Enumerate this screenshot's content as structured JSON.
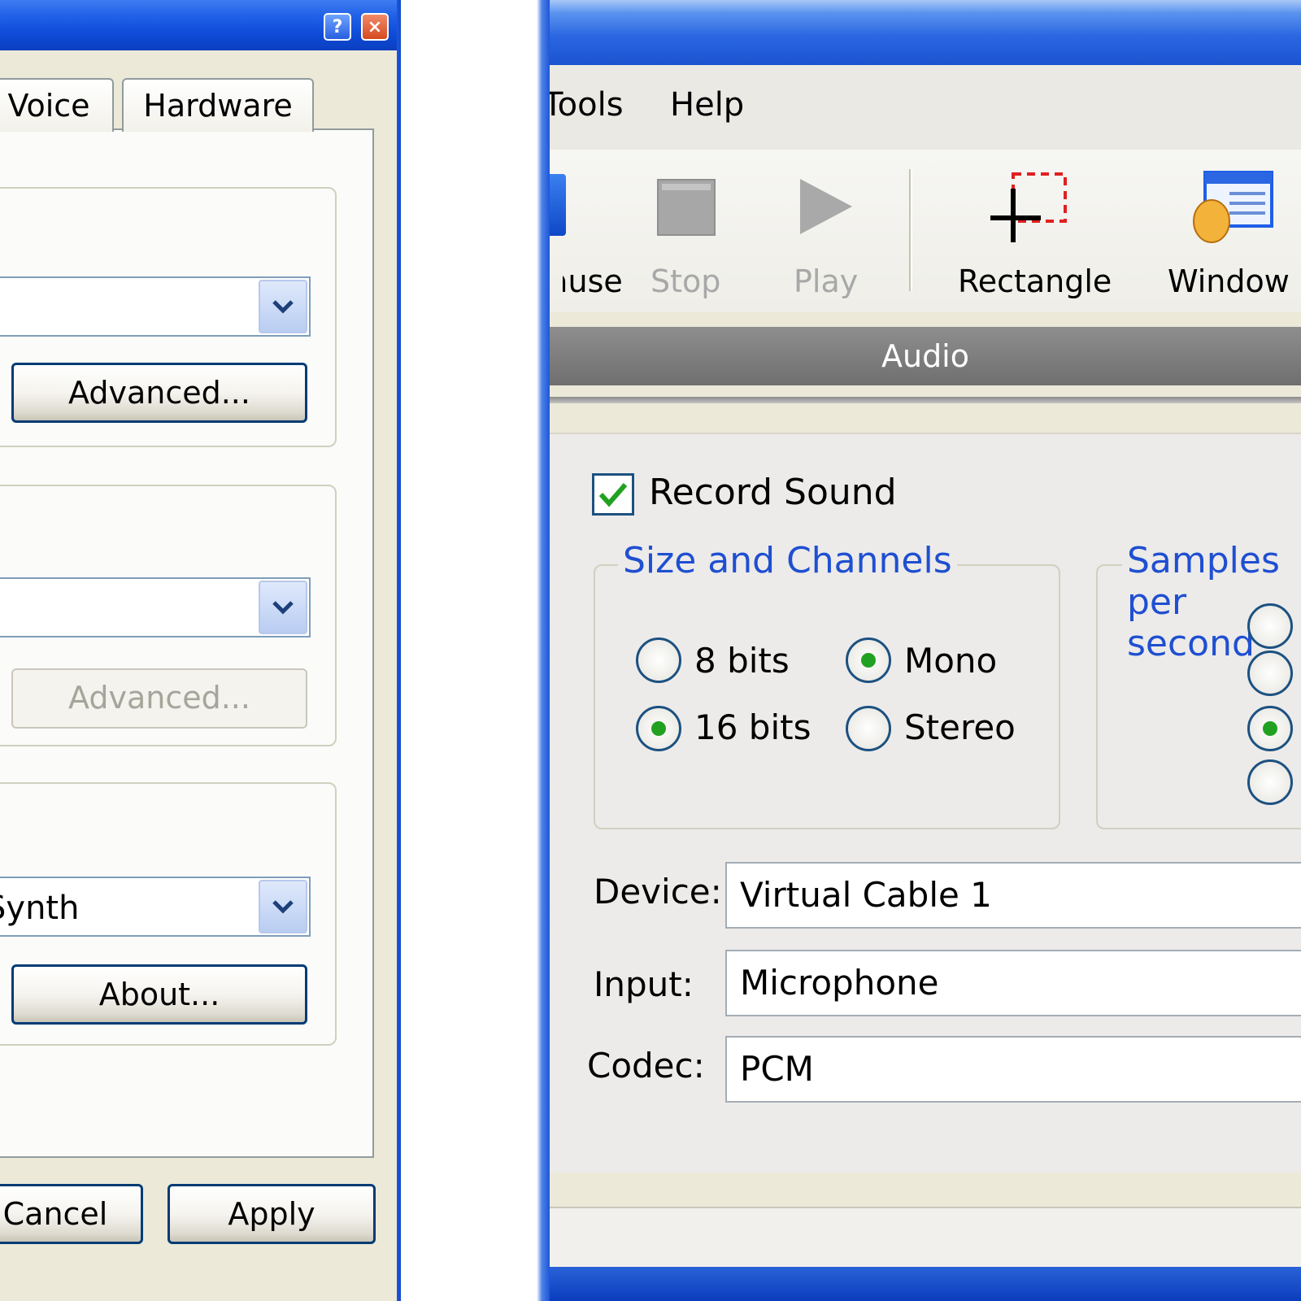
{
  "left_dialog": {
    "tabs": [
      {
        "label": "Voice"
      },
      {
        "label": "Hardware"
      }
    ],
    "combo_3_value": "Synth",
    "buttons": {
      "advanced_1": "Advanced...",
      "advanced_2": "Advanced...",
      "about": "About...",
      "cancel": "Cancel",
      "apply": "Apply"
    },
    "title_buttons": {
      "help": "?",
      "close": "×"
    }
  },
  "right_window": {
    "menu": {
      "tools": "Tools",
      "help": "Help"
    },
    "toolbar": {
      "pause": "Pause",
      "stop": "Stop",
      "play": "Play",
      "rectangle": "Rectangle",
      "window": "Window"
    },
    "section_header": "Audio",
    "record_sound": {
      "label": "Record Sound",
      "checked": true
    },
    "size_and_channels": {
      "legend": "Size and Channels",
      "options": {
        "bits8": {
          "label": "8 bits",
          "selected": false
        },
        "bits16": {
          "label": "16 bits",
          "selected": true
        },
        "mono": {
          "label": "Mono",
          "selected": true
        },
        "stereo": {
          "label": "Stereo",
          "selected": false
        }
      }
    },
    "samples": {
      "legend": "Samples per second",
      "radio_states": [
        false,
        false,
        true,
        false
      ]
    },
    "fields": {
      "device_label": "Device:",
      "device_value": "Virtual Cable 1",
      "input_label": "Input:",
      "input_value": "Microphone",
      "codec_label": "Codec:",
      "codec_value": "PCM"
    },
    "colors": {
      "title_blue": "#1f5ee6",
      "legend_blue": "#1f4fd1",
      "radio_green": "#21a121",
      "header_gray": "#7f7f7f"
    }
  }
}
